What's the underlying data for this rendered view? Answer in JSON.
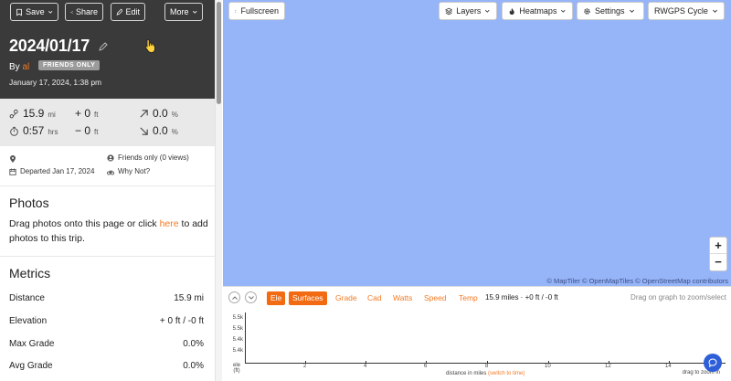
{
  "toolbar": {
    "save_label": "Save",
    "share_label": "Share",
    "edit_label": "Edit",
    "more_label": "More"
  },
  "trip": {
    "title": "2024/01/17",
    "by_label": "By",
    "user": "al",
    "visibility_badge": "FRIENDS ONLY",
    "datetime": "January 17, 2024, 1:38 pm"
  },
  "stats": {
    "distance": {
      "value": "15.9",
      "unit": "mi"
    },
    "elevation_gain": {
      "value": "+ 0",
      "unit": "ft"
    },
    "grade_up": {
      "value": "0.0",
      "unit": "%"
    },
    "duration": {
      "value": "0:57",
      "unit": "hrs"
    },
    "elevation_loss": {
      "value": "− 0",
      "unit": "ft"
    },
    "grade_down": {
      "value": "0.0",
      "unit": "%"
    }
  },
  "meta": {
    "privacy": "Friends only (0 views)",
    "departed": "Departed Jan 17, 2024",
    "activity": "Why Not?"
  },
  "photos": {
    "heading": "Photos",
    "text_before": "Drag photos onto this page or click ",
    "link": "here",
    "text_after": " to add photos to this trip."
  },
  "metrics": {
    "heading": "Metrics",
    "rows": [
      {
        "label": "Distance",
        "value": "15.9 mi"
      },
      {
        "label": "Elevation",
        "value": "+ 0 ft / -0 ft"
      },
      {
        "label": "Max Grade",
        "value": "0.0%"
      },
      {
        "label": "Avg Grade",
        "value": "0.0%"
      }
    ]
  },
  "map": {
    "fullscreen_label": "Fullscreen",
    "layers_label": "Layers",
    "heatmaps_label": "Heatmaps",
    "settings_label": "Settings",
    "basemap_label": "RWGPS Cycle",
    "zoom_in": "+",
    "zoom_out": "−",
    "attribution": "© MapTiler © OpenMapTiles © OpenStreetMap contributors",
    "background_color": "#96b4f8"
  },
  "elevation_graph": {
    "tabs": [
      "Ele",
      "Surfaces",
      "Grade",
      "Cad",
      "Watts",
      "Speed",
      "Temp"
    ],
    "active_tabs": [
      "Ele",
      "Surfaces"
    ],
    "summary": "15.9 miles · +0 ft / -0 ft",
    "hint": "Drag on graph to zoom/select",
    "y_ticks": [
      "5.5k",
      "5.5k",
      "5.4k",
      "5.4k"
    ],
    "y_axis_label": "ele",
    "y_axis_unit": "(ft)",
    "x_ticks": [
      "2",
      "4",
      "6",
      "8",
      "10",
      "12",
      "14"
    ],
    "x_axis_label": "distance in miles",
    "x_switch_link": "(switch to time)",
    "x_hint": "drag to zoom in"
  },
  "colors": {
    "accent": "#f47a24",
    "header_bg": "#3a3a3a",
    "stats_bg": "#e9e9e9"
  }
}
